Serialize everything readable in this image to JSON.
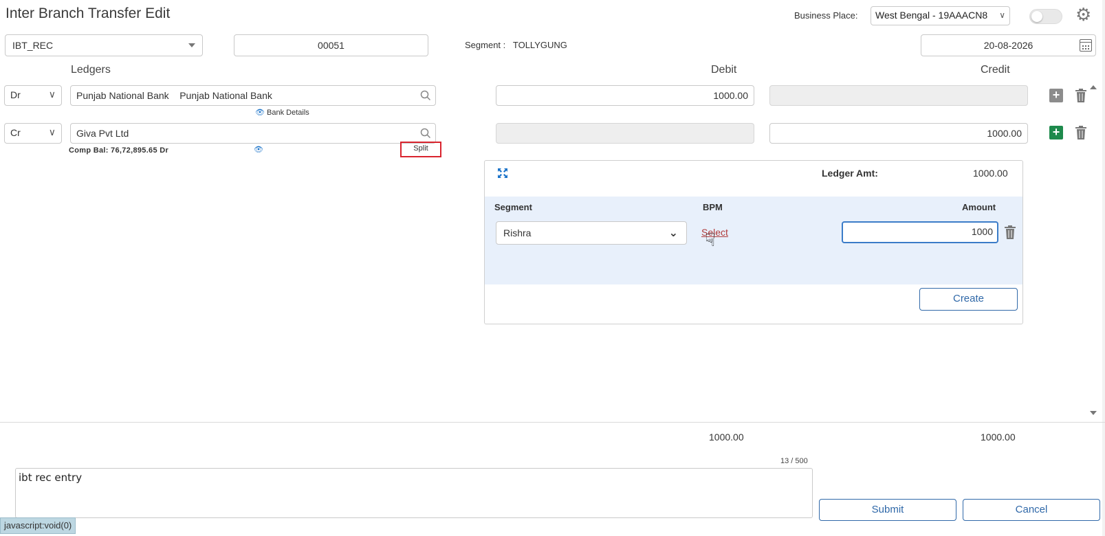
{
  "header": {
    "title": "Inter Branch Transfer Edit",
    "business_place_label": "Business Place:",
    "business_place_value": "West Bengal - 19AAACN8"
  },
  "form": {
    "voucher_type": "IBT_REC",
    "voucher_number": "00051",
    "segment_label": "Segment :",
    "segment_value": "TOLLYGUNG",
    "date": "20-08-2026"
  },
  "columns": {
    "ledgers": "Ledgers",
    "debit": "Debit",
    "credit": "Credit"
  },
  "rows": [
    {
      "drcr": "Dr",
      "ledger": "Punjab National Bank    Punjab National Bank",
      "sub_link": "Bank Details",
      "debit": "1000.00",
      "credit": ""
    },
    {
      "drcr": "Cr",
      "ledger": "Giva Pvt Ltd",
      "comp_bal": "Comp Bal: 76,72,895.65 Dr",
      "split_label": "Split",
      "debit": "",
      "credit": "1000.00"
    }
  ],
  "split_panel": {
    "ledger_amt_label": "Ledger Amt:",
    "ledger_amt_value": "1000.00",
    "col_segment": "Segment",
    "col_bpm": "BPM",
    "col_amount": "Amount",
    "segment_value": "Rishra",
    "bpm_link": "Select",
    "amount_value": "1000",
    "create_label": "Create"
  },
  "totals": {
    "debit": "1000.00",
    "credit": "1000.00"
  },
  "narration": {
    "counter": "13 / 500",
    "text": "ibt rec entry"
  },
  "actions": {
    "submit": "Submit",
    "cancel": "Cancel"
  },
  "status_bar": "javascript:void(0)",
  "colors": {
    "accent": "#2f68a8",
    "add_active": "#1e8a4c",
    "add_inactive": "#8c8c8c",
    "split_highlight": "#d9232d",
    "panel_bg": "#e8f0fb"
  }
}
